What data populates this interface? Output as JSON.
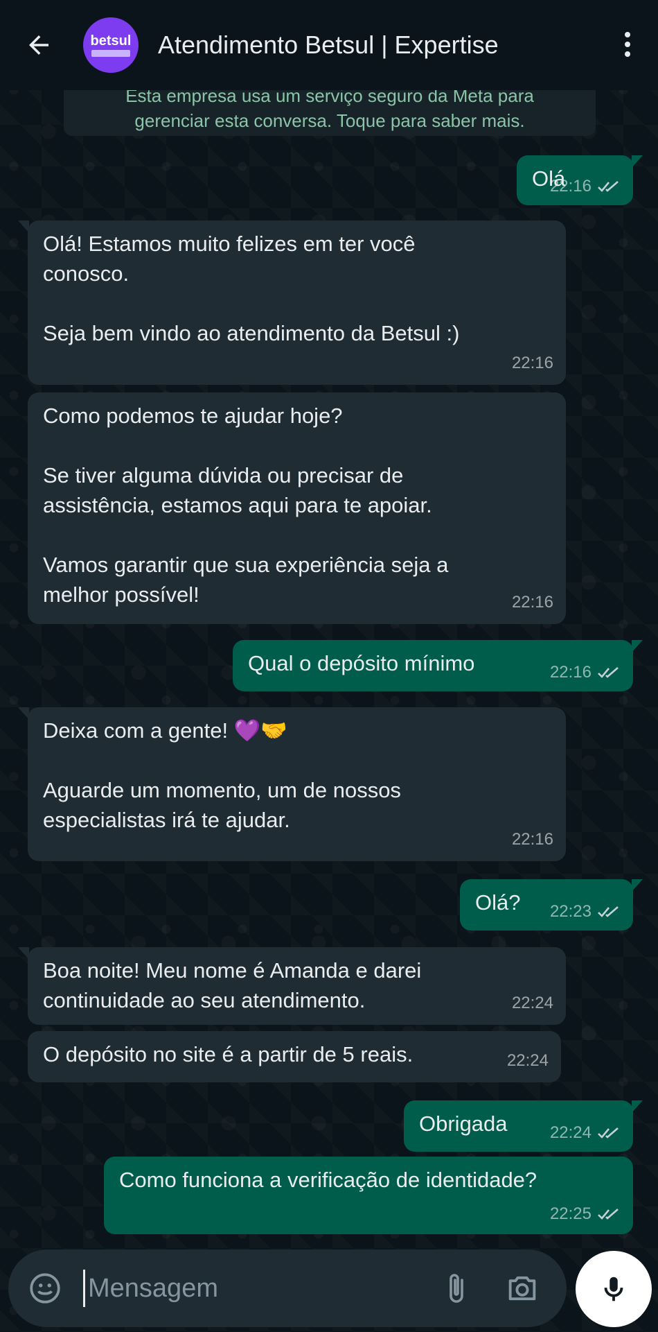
{
  "header": {
    "title": "Atendimento Betsul | Expertise",
    "avatar_text": "betsul"
  },
  "notice": {
    "line1": "Esta empresa usa um serviço seguro da Meta para",
    "line2": "gerenciar esta conversa. Toque para saber mais."
  },
  "messages": [
    {
      "dir": "out",
      "text": "Olá",
      "time": "22:16"
    },
    {
      "dir": "in",
      "text": "Olá! Estamos muito felizes em ter você\nconosco.\n\nSeja bem vindo ao atendimento da Betsul :)",
      "time": "22:16"
    },
    {
      "dir": "in",
      "text": "Como podemos te ajudar hoje?\n\nSe tiver alguma dúvida ou precisar de\nassistência, estamos aqui para te apoiar.\n\nVamos garantir que sua experiência seja a\nmelhor possível!",
      "time": "22:16"
    },
    {
      "dir": "out",
      "text": "Qual o depósito mínimo",
      "time": "22:16"
    },
    {
      "dir": "in",
      "text": "Deixa com a gente! 💜🤝\n\nAguarde um momento, um de nossos\nespecialistas irá te ajudar.",
      "time": "22:16"
    },
    {
      "dir": "out",
      "text": "Olá?",
      "time": "22:23"
    },
    {
      "dir": "in",
      "text": "Boa noite! Meu nome é Amanda e darei\ncontinuidade ao seu atendimento.",
      "time": "22:24"
    },
    {
      "dir": "in",
      "text": "O depósito no site é a partir de 5 reais.",
      "time": "22:24"
    },
    {
      "dir": "out",
      "text": "Obrigada",
      "time": "22:24"
    },
    {
      "dir": "out",
      "text": "Como funciona a verificação de identidade?",
      "time": "22:25"
    }
  ],
  "composer": {
    "placeholder": "Mensagem"
  },
  "colors": {
    "background": "#0b141a",
    "incoming_bubble": "#202c33",
    "outgoing_bubble": "#005c4b",
    "brand": "#7d3cf0",
    "read_ticks": "#8696a0"
  },
  "icons": [
    "back-arrow-icon",
    "more-vert-icon",
    "double-check-icon",
    "emoji-icon",
    "attach-icon",
    "camera-icon",
    "mic-icon"
  ]
}
